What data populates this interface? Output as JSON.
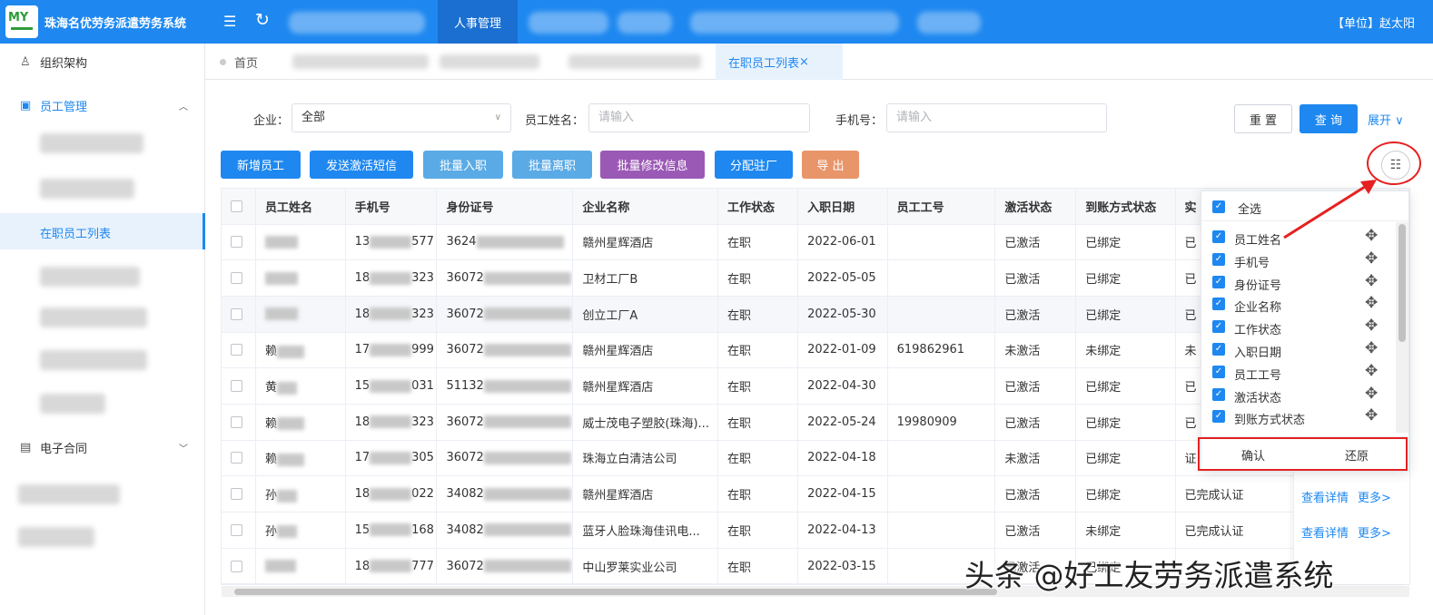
{
  "header": {
    "app_title": "珠海名优劳务派遣劳务系统",
    "logo_text": "MY",
    "active_nav": "人事管理",
    "user_label": "【单位】赵太阳",
    "colors": {
      "primary": "#1e88f0",
      "active_nav_bg": "#1a6fd0"
    }
  },
  "sidebar": {
    "org": "组织架构",
    "staff_mgmt": "员工管理",
    "active_item": "在职员工列表",
    "contract": "电子合同"
  },
  "tabs": {
    "home": "首页",
    "active": "在职员工列表",
    "close": "×"
  },
  "filters": {
    "company_label": "企业：",
    "company_value": "全部",
    "name_label": "员工姓名：",
    "name_placeholder": "请输入",
    "phone_label": "手机号：",
    "phone_placeholder": "请输入",
    "reset": "重 置",
    "query": "查 询",
    "expand": "展开 ∨"
  },
  "actions": [
    {
      "label": "新增员工",
      "color": "#1e88f0"
    },
    {
      "label": "发送激活短信",
      "color": "#1e88f0"
    },
    {
      "label": "批量入职",
      "color": "#5aaae6"
    },
    {
      "label": "批量离职",
      "color": "#5aaae6"
    },
    {
      "label": "批量修改信息",
      "color": "#9b59b6"
    },
    {
      "label": "分配驻厂",
      "color": "#1e88f0"
    },
    {
      "label": "导 出",
      "color": "#e8956a"
    }
  ],
  "table": {
    "headers": [
      "员工姓名",
      "手机号",
      "身份证号",
      "企业名称",
      "工作状态",
      "入职日期",
      "员工工号",
      "激活状态",
      "到账方式状态",
      "实"
    ],
    "rows": [
      {
        "name": "",
        "phone_pre": "13",
        "phone_suf": "577",
        "id_pre": "3624",
        "company": "赣州星辉酒店",
        "status": "在职",
        "date": "2022-06-01",
        "empno": "",
        "active": "已激活",
        "pay": "已绑定",
        "real": "已"
      },
      {
        "name": "",
        "phone_pre": "18",
        "phone_suf": "323",
        "id_pre": "36072",
        "company": "卫材工厂B",
        "status": "在职",
        "date": "2022-05-05",
        "empno": "",
        "active": "已激活",
        "pay": "已绑定",
        "real": "已"
      },
      {
        "name": "",
        "phone_pre": "18",
        "phone_suf": "323",
        "id_pre": "36072",
        "company": "创立工厂A",
        "status": "在职",
        "date": "2022-05-30",
        "empno": "",
        "active": "已激活",
        "pay": "已绑定",
        "real": "已"
      },
      {
        "name": "赖",
        "phone_pre": "17",
        "phone_suf": "999",
        "id_pre": "36072",
        "company": "赣州星辉酒店",
        "status": "在职",
        "date": "2022-01-09",
        "empno": "619862961",
        "active": "未激活",
        "pay": "未绑定",
        "real": "未"
      },
      {
        "name": "黄",
        "phone_pre": "15",
        "phone_suf": "031",
        "id_pre": "51132",
        "company": "赣州星辉酒店",
        "status": "在职",
        "date": "2022-04-30",
        "empno": "",
        "active": "已激活",
        "pay": "已绑定",
        "real": "已"
      },
      {
        "name": "赖",
        "phone_pre": "18",
        "phone_suf": "323",
        "id_pre": "36072",
        "company": "威士茂电子塑胶(珠海)...",
        "status": "在职",
        "date": "2022-05-24",
        "empno": "19980909",
        "active": "已激活",
        "pay": "已绑定",
        "real": "已"
      },
      {
        "name": "赖",
        "phone_pre": "17",
        "phone_suf": "305",
        "id_pre": "36072",
        "company": "珠海立白清洁公司",
        "status": "在职",
        "date": "2022-04-18",
        "empno": "",
        "active": "未激活",
        "pay": "已绑定",
        "real": "证"
      },
      {
        "name": "孙",
        "phone_pre": "18",
        "phone_suf": "022",
        "id_pre": "34082",
        "company": "赣州星辉酒店",
        "status": "在职",
        "date": "2022-04-15",
        "empno": "",
        "active": "已激活",
        "pay": "已绑定",
        "real": "已完成认证"
      },
      {
        "name": "孙",
        "phone_pre": "15",
        "phone_suf": "168",
        "id_pre": "34082",
        "company": "蓝牙人脸珠海佳讯电...",
        "status": "在职",
        "date": "2022-04-13",
        "empno": "",
        "active": "已激活",
        "pay": "未绑定",
        "real": "已完成认证"
      },
      {
        "name": "",
        "phone_pre": "18",
        "phone_suf": "777",
        "id_pre": "36072",
        "company": "中山罗莱实业公司",
        "status": "在职",
        "date": "2022-03-15",
        "empno": "",
        "active": "已激活",
        "pay": "已绑定",
        "real": ""
      }
    ]
  },
  "column_popup": {
    "select_all": "全选",
    "items": [
      "员工姓名",
      "手机号",
      "身份证号",
      "企业名称",
      "工作状态",
      "入职日期",
      "员工工号",
      "激活状态",
      "到账方式状态"
    ],
    "confirm": "确认",
    "restore": "还原"
  },
  "ops": {
    "detail": "查看详情",
    "more": "更多>"
  },
  "watermark": "头条 @好工友劳务派遣系统"
}
